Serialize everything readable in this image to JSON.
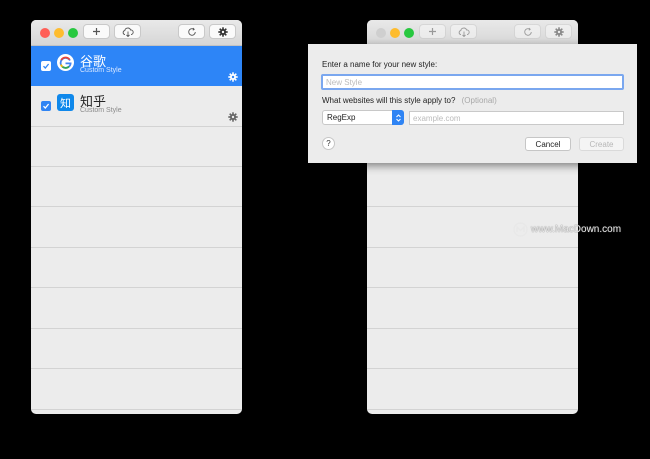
{
  "left_window": {
    "toolbar": {
      "add_icon": "plus-icon",
      "download_icon": "cloud-download-icon",
      "reload_icon": "reload-icon",
      "settings_icon": "gear-icon"
    },
    "styles": [
      {
        "name": "谷歌",
        "subtitle": "Custom Style",
        "icon": "google-icon",
        "checked": true,
        "selected": true
      },
      {
        "name": "知乎",
        "subtitle": "Custom Style",
        "icon": "zhihu-icon",
        "icon_text": "知",
        "checked": true,
        "selected": false
      }
    ]
  },
  "dialog": {
    "name_prompt": "Enter a name for your new style:",
    "name_placeholder": "New Style",
    "websites_prompt": "What websites will this style apply to?",
    "optional_label": "(Optional)",
    "match_type": "RegExp",
    "url_placeholder": "example.com",
    "help_label": "?",
    "cancel_label": "Cancel",
    "create_label": "Create"
  },
  "watermark": {
    "text": "www.MacDown.com"
  },
  "colors": {
    "accent": "#2d85f7",
    "close": "#ff5f57",
    "minimize": "#febc2e",
    "zoom": "#28c840",
    "zhihu": "#0f88eb"
  }
}
